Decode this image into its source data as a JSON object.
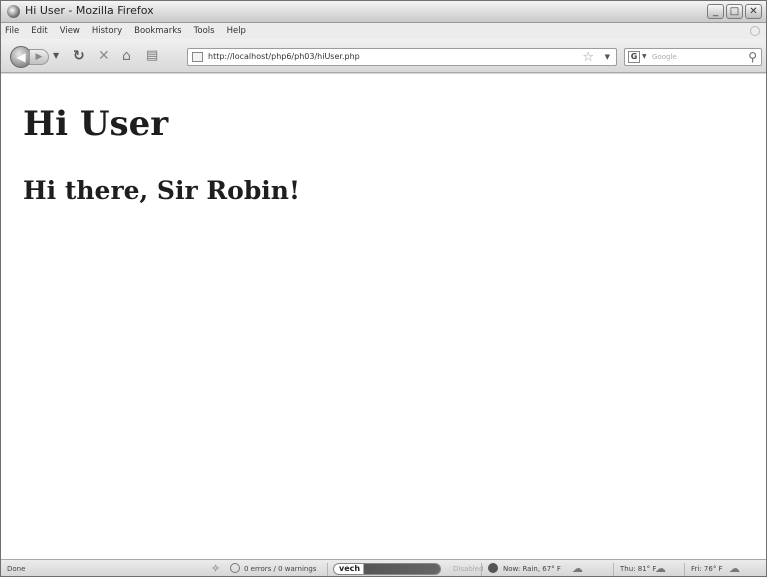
{
  "window": {
    "title": "Hi User - Mozilla Firefox",
    "controls": {
      "minimize": "_",
      "maximize": "□",
      "close": "✕"
    }
  },
  "menubar": {
    "items": [
      "File",
      "Edit",
      "View",
      "History",
      "Bookmarks",
      "Tools",
      "Help"
    ]
  },
  "navbar": {
    "url": "http://localhost/php6/ph03/hiUser.php",
    "search_placeholder": "Google",
    "search_engine_letter": "G",
    "icons": {
      "back": "back-arrow-icon",
      "forward": "forward-arrow-icon",
      "reload": "reload-icon",
      "stop": "stop-icon",
      "home": "home-icon",
      "bookmark": "bookmark-icon",
      "star": "star-icon",
      "search": "magnifier-icon"
    }
  },
  "content": {
    "heading1": "Hi User",
    "heading2": "Hi there, Sir Robin!"
  },
  "statusbar": {
    "status": "Done",
    "errors": "0 errors / 0 warnings",
    "vech_label": "vech",
    "disabled": "Disabled",
    "now_weather": "Now: Rain, 67° F",
    "thu_weather": "Thu: 81° F",
    "fri_weather": "Fri: 76° F"
  }
}
